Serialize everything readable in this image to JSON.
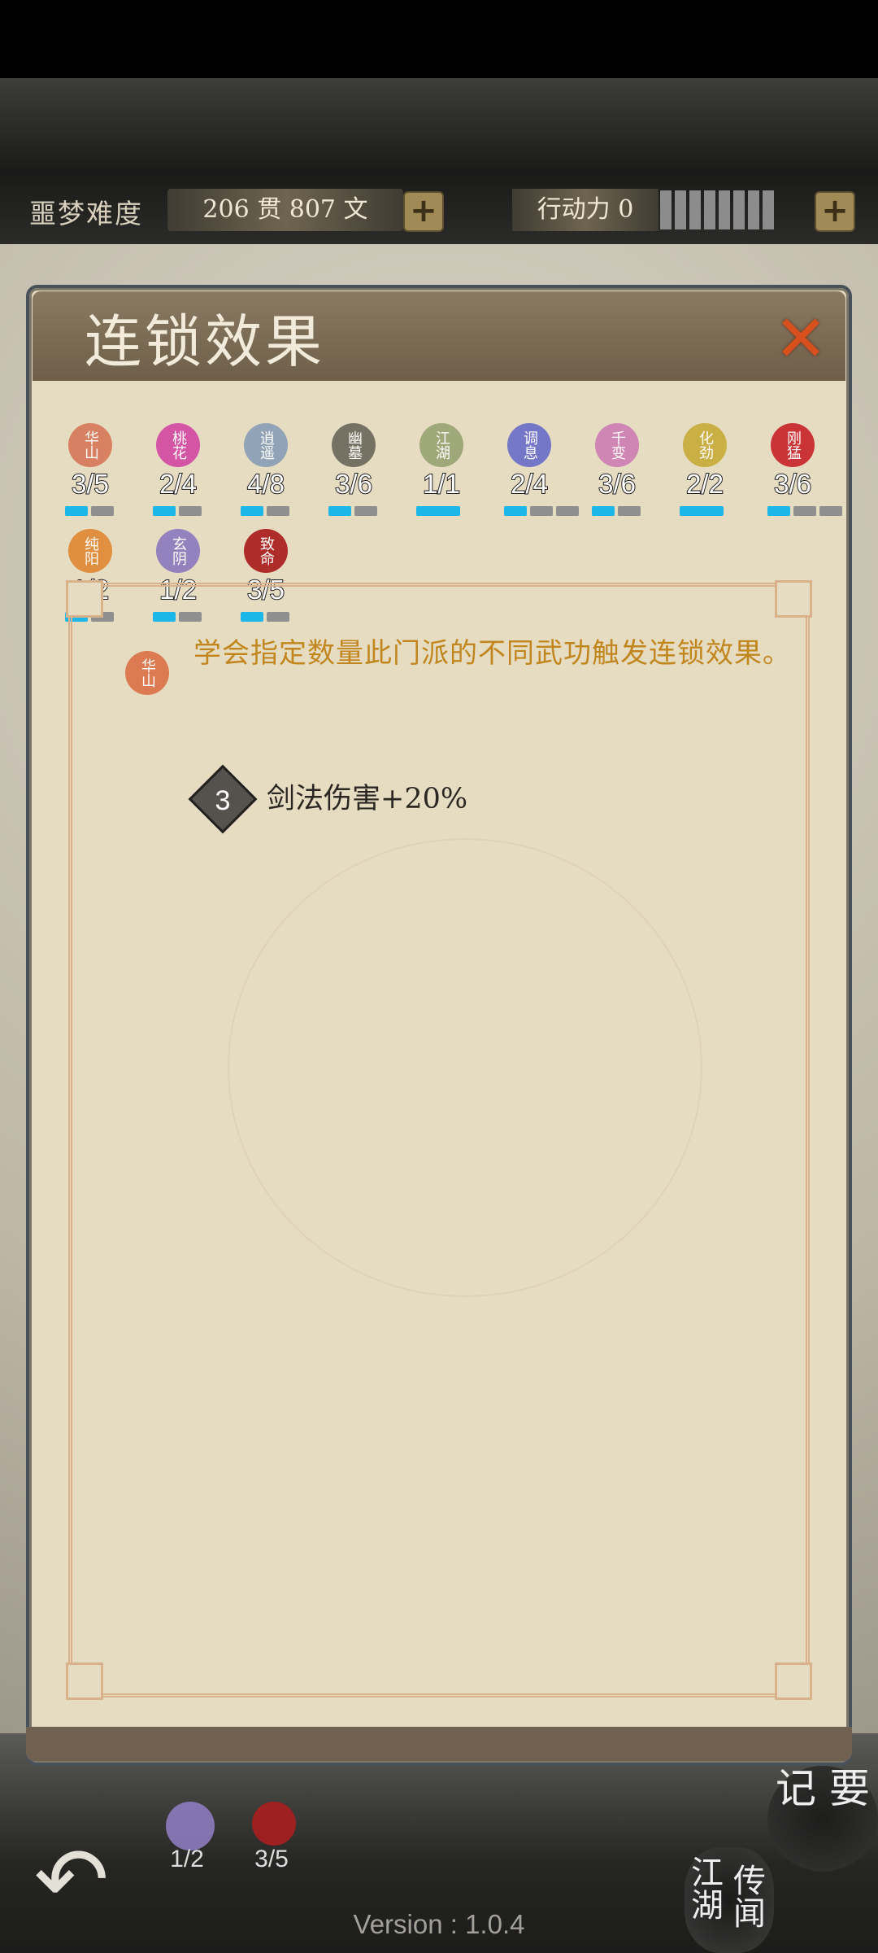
{
  "header": {
    "difficulty": "噩梦难度",
    "currency": "206 贯  807  文",
    "action_power": "行动力 0",
    "plus": "+"
  },
  "panel": {
    "title": "连锁效果",
    "close": "✕"
  },
  "sects": [
    {
      "name": "华山",
      "count": "3/5",
      "color": "#d77a5a",
      "bars": [
        1,
        0
      ]
    },
    {
      "name": "桃花",
      "count": "2/4",
      "color": "#d34aa2",
      "bars": [
        1,
        0
      ]
    },
    {
      "name": "逍遥",
      "count": "4/8",
      "color": "#8a9fb5",
      "bars": [
        1,
        0
      ]
    },
    {
      "name": "幽墓",
      "count": "3/6",
      "color": "#6d6a5c",
      "bars": [
        1,
        0
      ]
    },
    {
      "name": "江湖",
      "count": "1/1",
      "color": "#9aa473",
      "bars": [
        2
      ]
    },
    {
      "name": "调息",
      "count": "2/4",
      "color": "#6b6fc8",
      "bars": [
        1,
        0,
        0
      ]
    },
    {
      "name": "千变",
      "count": "3/6",
      "color": "#cf7fb4",
      "bars": [
        1,
        0
      ]
    },
    {
      "name": "化劲",
      "count": "2/2",
      "color": "#c8ac3a",
      "bars": [
        2
      ]
    },
    {
      "name": "刚猛",
      "count": "3/6",
      "color": "#c8262c",
      "bars": [
        1,
        0,
        0
      ]
    },
    {
      "name": "纯阳",
      "count": "1/2",
      "color": "#e08935",
      "bars": [
        1,
        0
      ]
    },
    {
      "name": "玄阴",
      "count": "1/2",
      "color": "#8d7bbe",
      "bars": [
        1,
        0
      ]
    },
    {
      "name": "致命",
      "count": "3/5",
      "color": "#aa1e1e",
      "bars": [
        1,
        0
      ]
    }
  ],
  "detail": {
    "sect_seal": "华山",
    "description": "学会指定数量此门派的不同武功触发连锁效果。",
    "tier": "3",
    "effect": "剑法伤害+20%"
  },
  "bottom": {
    "back_icon": "back-arrow-icon",
    "jiyao": "记 要",
    "jianghu": "江湖",
    "chuanwen": "传闻",
    "version": "Version : 1.0.4",
    "bg_sects": [
      {
        "name": "玄阴",
        "count": "1/2"
      },
      {
        "name": "致命",
        "count": "3/5"
      }
    ]
  }
}
